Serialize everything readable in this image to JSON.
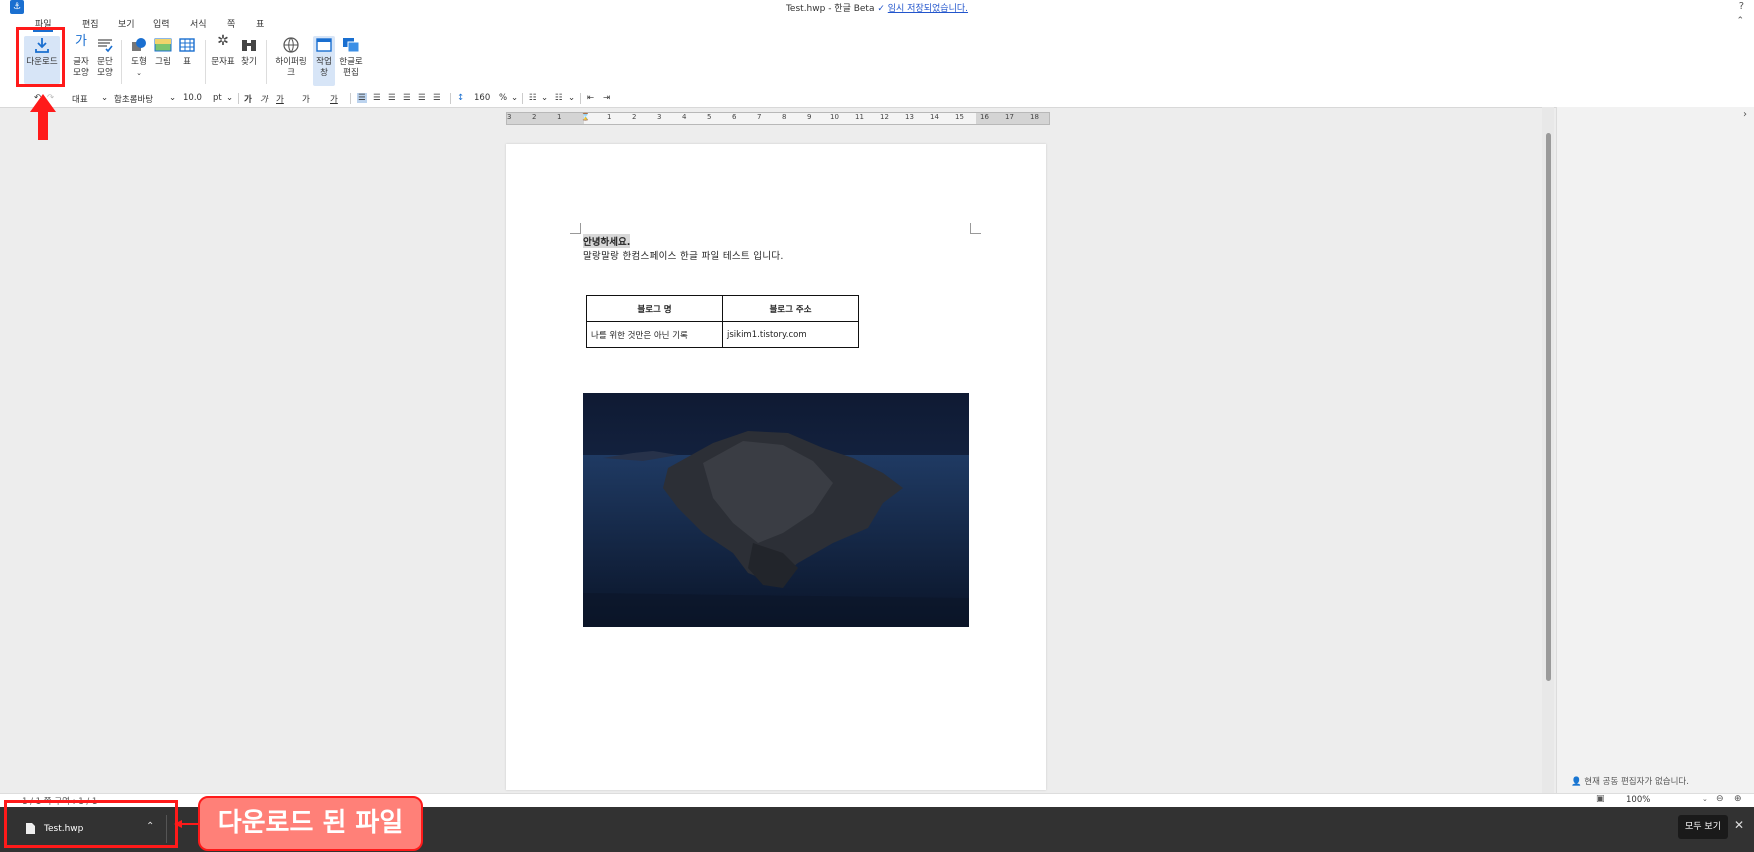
{
  "titlebar": {
    "title": "Test.hwp - 한글 Beta",
    "save_status": "임시 저장되었습니다.",
    "help": "?"
  },
  "menu": [
    "파일",
    "편집",
    "보기",
    "입력",
    "서식",
    "쪽",
    "표"
  ],
  "ribbon": {
    "download": "다운로드",
    "char_shape": [
      "글자",
      "모양"
    ],
    "para_shape": [
      "문단",
      "모양"
    ],
    "shape": "도형",
    "picture": "그림",
    "table": "표",
    "symbol": "문자표",
    "find": "찾기",
    "hyperlink": "하이퍼링크",
    "task_pane": [
      "작업",
      "창"
    ],
    "hangul_edit": [
      "한글로",
      "편집"
    ]
  },
  "format": {
    "style": "대표",
    "font": "함초롬바탕",
    "size": "10.0",
    "unit": "pt",
    "line_spacing": "160",
    "line_spacing_unit": "%"
  },
  "ruler_numbers": [
    "3",
    "2",
    "1",
    "",
    "1",
    "2",
    "3",
    "4",
    "5",
    "6",
    "7",
    "8",
    "9",
    "10",
    "11",
    "12",
    "13",
    "14",
    "15",
    "16",
    "17",
    "18"
  ],
  "document": {
    "line1": "안녕하세요.",
    "line2": "말랑말랑 한컴스페이스 한글 파일 테스트 입니다.",
    "table_headers": [
      "블로그 명",
      "블로그 주소"
    ],
    "table_row": [
      "나를 위한 것만은 아닌 기록",
      "jsikim1.tistory.com"
    ]
  },
  "right_pane": {
    "coeditor_text": "현재 공동 편집자가 없습니다."
  },
  "statusbar": {
    "left": "1 / 1 쪽   구역 : 1 / 1",
    "zoom": "100%"
  },
  "download_bar": {
    "filename": "Test.hwp",
    "show_all": "모두 보기"
  },
  "annotation": {
    "label": "다운로드 된 파일"
  },
  "colors": {
    "accent": "#1a6fd0",
    "annotation_red": "#ff1a1a",
    "annotation_fill": "#ff8078",
    "download_bar": "#323232"
  }
}
